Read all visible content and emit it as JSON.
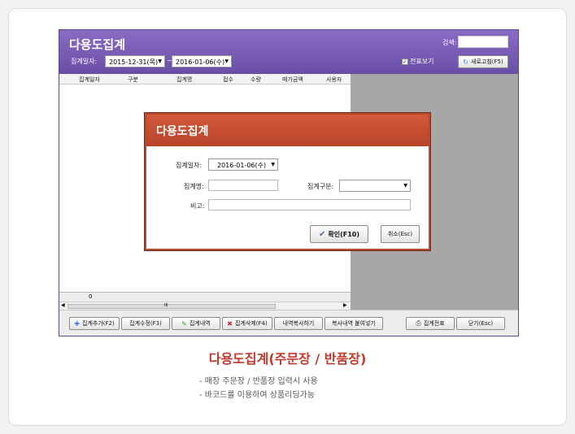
{
  "app": {
    "title": "다용도집계",
    "search_label": "검색:",
    "search_value": "",
    "period_label": "집계일자:",
    "start_date": "2015-12-31(목)",
    "tilde": "~",
    "end_date": "2016-01-06(수)",
    "checkbox_label": "전표보기",
    "checkbox_checked": true,
    "refresh_label": "새로고침(F5)"
  },
  "grid": {
    "columns": [
      "집계일자",
      "구분",
      "집계명",
      "접수",
      "수량",
      "매가금액",
      "사용자"
    ],
    "footer_value": "0",
    "scroll_marker": "III"
  },
  "toolbar": {
    "add": "집계추가(F2)",
    "edit": "집계수정(F3)",
    "detail": "집계내역",
    "delete": "집계삭제(F4)",
    "copy": "내역복사하기",
    "paste": "복사내역 붙여넣기",
    "slip": "집계전표",
    "close": "닫기(Esc)"
  },
  "modal": {
    "title": "다용도집계",
    "date_label": "집계일자:",
    "date_value": "2016-01-06(수)",
    "name_label": "집계명:",
    "name_value": "",
    "type_label": "집계구분:",
    "type_value": "",
    "note_label": "비고:",
    "note_value": "",
    "ok_label": "확인(F10)",
    "cancel_label": "취소(Esc)"
  },
  "caption": {
    "title": "다용도집계(주문장 / 반품장)",
    "line1": "- 매장 주문장 / 반품장 입력시 사용",
    "line2": "- 바코드를 이용하여 상품리딩가능"
  }
}
